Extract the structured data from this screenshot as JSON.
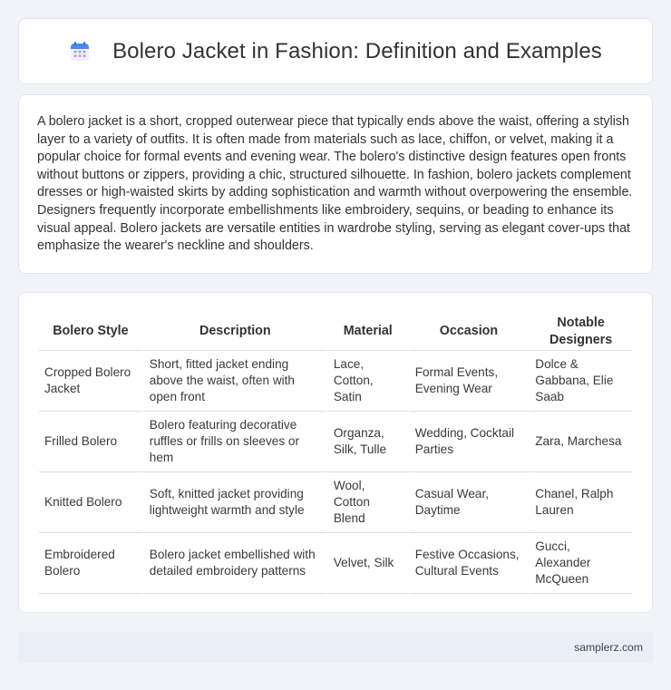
{
  "header": {
    "title": "Bolero Jacket in Fashion: Definition and Examples",
    "icon": "calendar-icon"
  },
  "intro": {
    "text": "A bolero jacket is a short, cropped outerwear piece that typically ends above the waist, offering a stylish layer to a variety of outfits. It is often made from materials such as lace, chiffon, or velvet, making it a popular choice for formal events and evening wear. The bolero's distinctive design features open fronts without buttons or zippers, providing a chic, structured silhouette. In fashion, bolero jackets complement dresses or high-waisted skirts by adding sophistication and warmth without overpowering the ensemble. Designers frequently incorporate embellishments like embroidery, sequins, or beading to enhance its visual appeal. Bolero jackets are versatile entities in wardrobe styling, serving as elegant cover-ups that emphasize the wearer's neckline and shoulders."
  },
  "table": {
    "headers": [
      "Bolero Style",
      "Description",
      "Material",
      "Occasion",
      "Notable Designers"
    ],
    "rows": [
      [
        "Cropped Bolero Jacket",
        "Short, fitted jacket ending above the waist, often with open front",
        "Lace, Cotton, Satin",
        "Formal Events, Evening Wear",
        "Dolce & Gabbana, Elie Saab"
      ],
      [
        "Frilled Bolero",
        "Bolero featuring decorative ruffles or frills on sleeves or hem",
        "Organza, Silk, Tulle",
        "Wedding, Cocktail Parties",
        "Zara, Marchesa"
      ],
      [
        "Knitted Bolero",
        "Soft, knitted jacket providing lightweight warmth and style",
        "Wool, Cotton Blend",
        "Casual Wear, Daytime",
        "Chanel, Ralph Lauren"
      ],
      [
        "Embroidered Bolero",
        "Bolero jacket embellished with detailed embroidery patterns",
        "Velvet, Silk",
        "Festive Occasions, Cultural Events",
        "Gucci, Alexander McQueen"
      ]
    ]
  },
  "footer": {
    "site": "samplerz.com"
  },
  "colors": {
    "background": "#f1f3f8",
    "card": "#ffffff",
    "footer_bar": "#e9eef7",
    "icon_blue": "#4a8be8",
    "icon_purple": "#b49ae6"
  }
}
